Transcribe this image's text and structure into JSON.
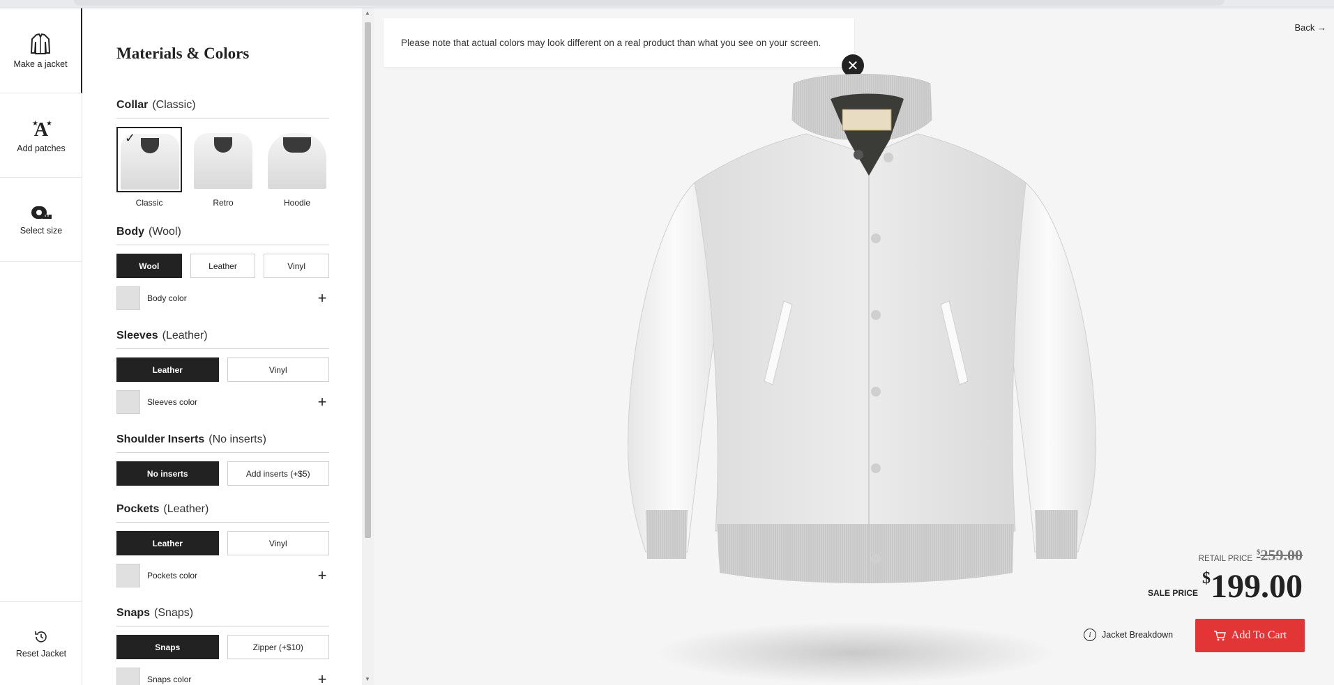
{
  "nav": {
    "make": "Make a jacket",
    "patches": "Add patches",
    "size": "Select size",
    "reset": "Reset Jacket"
  },
  "panel": {
    "title": "Materials & Colors",
    "collar": {
      "label": "Collar",
      "value": "(Classic)",
      "options": [
        "Classic",
        "Retro",
        "Hoodie"
      ]
    },
    "body": {
      "label": "Body",
      "value": "(Wool)",
      "options": [
        "Wool",
        "Leather",
        "Vinyl"
      ],
      "color_label": "Body color"
    },
    "sleeves": {
      "label": "Sleeves",
      "value": "(Leather)",
      "options": [
        "Leather",
        "Vinyl"
      ],
      "color_label": "Sleeves color"
    },
    "inserts": {
      "label": "Shoulder Inserts",
      "value": "(No inserts)",
      "options": [
        "No inserts",
        "Add inserts (+$5)"
      ]
    },
    "pockets": {
      "label": "Pockets",
      "value": "(Leather)",
      "options": [
        "Leather",
        "Vinyl"
      ],
      "color_label": "Pockets color"
    },
    "snaps": {
      "label": "Snaps",
      "value": "(Snaps)",
      "options": [
        "Snaps",
        "Zipper (+$10)"
      ],
      "color_label": "Snaps color"
    }
  },
  "stage": {
    "notice": "Please note that actual colors may look different on a real product than what you see on your screen.",
    "back": "Back",
    "retail_label": "RETAIL PRICE",
    "retail_currency": "$",
    "retail_price": "259.00",
    "sale_label": "SALE PRICE",
    "sale_currency": "$",
    "sale_price": "199.00",
    "breakdown": "Jacket Breakdown",
    "cart": "Add To Cart"
  },
  "colors": {
    "accent": "#e23636",
    "dark": "#222222"
  }
}
